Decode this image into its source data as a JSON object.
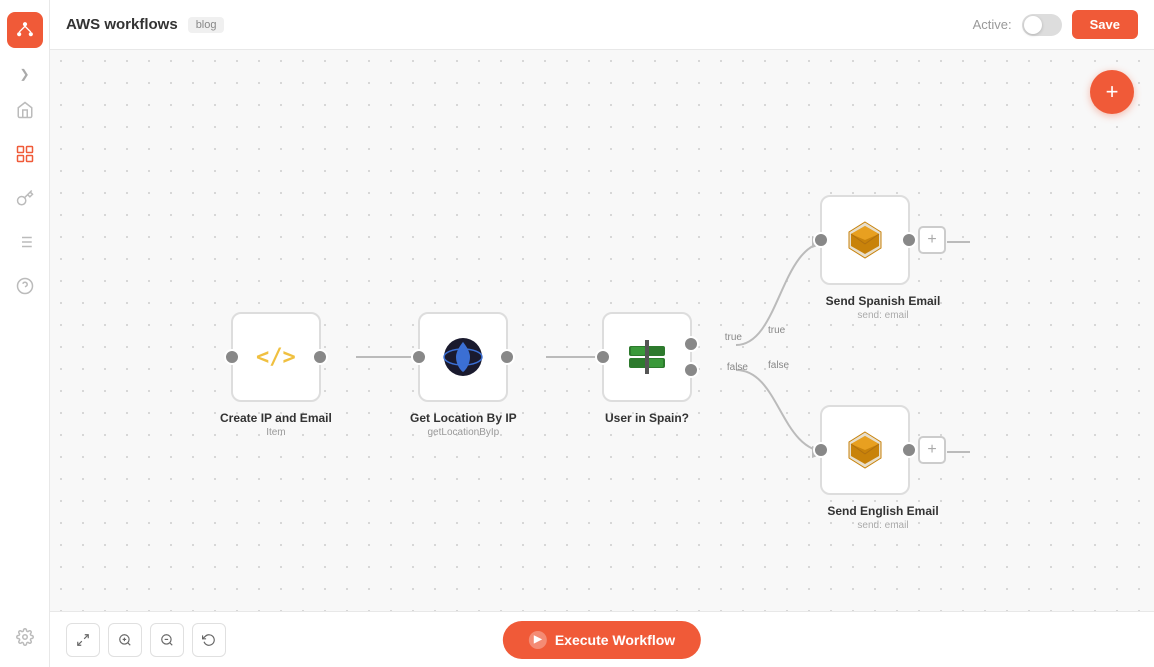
{
  "sidebar": {
    "logo_label": "workflow-logo",
    "items": [
      {
        "name": "expand-icon",
        "icon": "❯",
        "active": false
      },
      {
        "name": "home-icon",
        "icon": "⌂",
        "active": false
      },
      {
        "name": "network-icon",
        "icon": "⊞",
        "active": false
      },
      {
        "name": "key-icon",
        "icon": "🔑",
        "active": false
      },
      {
        "name": "list-icon",
        "icon": "≡",
        "active": false
      },
      {
        "name": "help-icon",
        "icon": "?",
        "active": false
      }
    ],
    "bottom_icon": "⚙"
  },
  "header": {
    "title": "AWS workflows",
    "badge": "blog",
    "active_label": "Active:",
    "toggle_on": false,
    "save_label": "Save"
  },
  "nodes": {
    "create_node": {
      "label": "Create IP and Email",
      "sublabel": "Item",
      "type": "code"
    },
    "get_location_node": {
      "label": "Get Location By IP",
      "sublabel": "getLocationByIp",
      "type": "api"
    },
    "condition_node": {
      "label": "User in Spain?",
      "type": "condition",
      "branch_true": "true",
      "branch_false": "false"
    },
    "spanish_email_node": {
      "label": "Send Spanish Email",
      "action": "send: email",
      "type": "aws"
    },
    "english_email_node": {
      "label": "Send English Email",
      "action": "send: email",
      "type": "aws"
    }
  },
  "toolbar": {
    "fit_label": "⛶",
    "zoom_in_label": "+",
    "zoom_out_label": "−",
    "reset_label": "↺",
    "execute_label": "Execute Workflow"
  },
  "fab": {
    "label": "+"
  },
  "colors": {
    "accent": "#f05a38",
    "node_border": "#ddd",
    "connector": "#888"
  }
}
